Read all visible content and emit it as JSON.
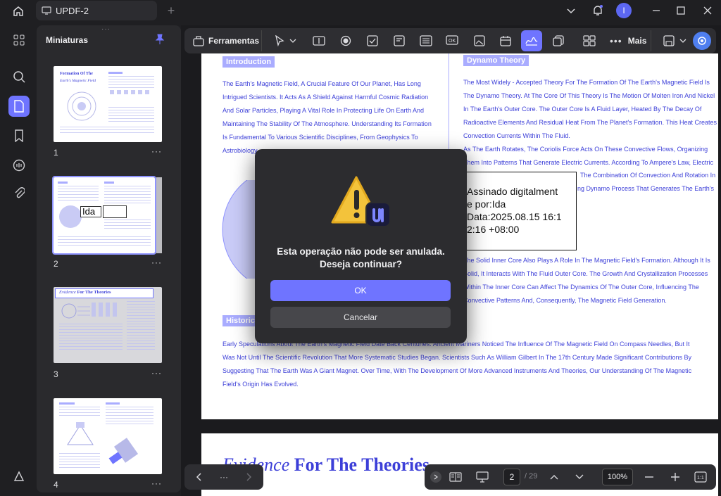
{
  "window": {
    "tab_title": "UPDF-2",
    "avatar_initial": "I"
  },
  "thumbnails": {
    "title": "Miniaturas",
    "pages": [
      {
        "number": "1",
        "heading": "Formation Of The",
        "subheading": "Earth's Magnetic Field"
      },
      {
        "number": "2",
        "signature_label": "Ida"
      },
      {
        "number": "3",
        "heading_italic": "Evidence",
        "heading_rest": "For The Theories"
      },
      {
        "number": "4"
      }
    ],
    "more_label": "···"
  },
  "toolbar": {
    "tools_label": "Ferramentas",
    "more_label": "Mais"
  },
  "document": {
    "intro_heading": "Introduction",
    "intro_lines": [
      "The Earth's Magnetic Field, A Crucial Feature Of Our Planet, Has Long",
      "Intrigued Scientists. It Acts As A Shield Against Harmful Cosmic Radiation",
      "And Solar Particles, Playing A Vital Role In Protecting Life On Earth And",
      "Maintaining The Stability Of The Atmosphere. Understanding Its Formation",
      "Is Fundamental To Various Scientific Disciplines, From Geophysics To",
      "Astrobiology"
    ],
    "dynamo_heading": "Dynamo Theory",
    "dynamo_lines": [
      "The Most Widely - Accepted Theory For The Formation Of The Earth's Magnetic Field Is",
      "The Dynamo Theory. At The Core Of This Theory Is The Motion Of Molten Iron And Nickel",
      "In The Earth's Outer Core. The Outer Core Is A Fluid Layer, Heated By The Decay Of",
      "Radioactive Elements And Residual Heat From The Planet's Formation. This Heat Creates",
      "Convection Currents Within The Fluid.",
      "As The Earth Rotates, The Coriolis Force Acts On These Convective Flows, Organizing",
      "Them Into Patterns That Generate Electric Currents. According To Ampere's Law, Electric",
      "The Combination Of Convection And Rotation In",
      "ng Dynamo Process That Generates The Earth's"
    ],
    "inner_core_lines": [
      "The Solid Inner Core Also Plays A Role In The Magnetic Field's Formation. Although It Is",
      "Solid, It Interacts With The Fluid Outer Core. The Growth And Crystallization Processes",
      "Within The Inner Core Can Affect The Dynamics Of The Outer Core, Influencing The",
      "Convective Patterns And, Consequently, The Magnetic Field Generation."
    ],
    "signature_lines": [
      "Assinado digitalment",
      "e por:Ida",
      "Data:2025.08.15 16:1",
      "2:16 +08:00"
    ],
    "historic_heading": "Historic",
    "historic_lines": [
      "Early Speculations About The Earth's Magnetic Field Date Back Centuries. Ancient Mariners Noticed The Influence Of The Magnetic Field On Compass Needles, But It",
      "Was Not Until The Scientific Revolution That More Systematic Studies Began. Scientists Such As William Gilbert In The 17th Century Made Significant Contributions By",
      "Suggesting That The Earth Was A Giant Magnet. Over Time, With The Development Of More Advanced Instruments And Theories, Our Understanding Of The Magnetic",
      "Field's Origin Has Evolved."
    ],
    "page2_heading_italic": "Evidence",
    "page2_heading_rest": "For The Theories"
  },
  "dialog": {
    "message_line1": "Esta operação não pode ser anulada.",
    "message_line2": "Deseja continuar?",
    "ok_label": "OK",
    "cancel_label": "Cancelar"
  },
  "pager": {
    "nav_more": "···",
    "current_page": "2",
    "total_pages": "/ 29",
    "zoom": "100%"
  },
  "colors": {
    "accent": "#6f74ff",
    "doc_text": "#3c3fd8",
    "heading_bg": "#a9acff"
  }
}
